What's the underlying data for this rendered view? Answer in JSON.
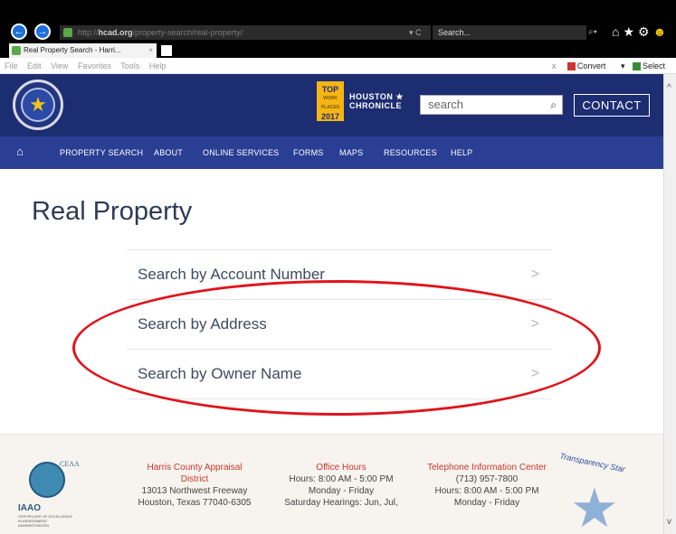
{
  "browser": {
    "url_prefix": "http://",
    "url_host": "hcad.org",
    "url_path": "/property-search/real-property/",
    "refresh_glyph": "▾ C",
    "search_placeholder": "Search...",
    "tab_title": "Real Property Search - Harri...",
    "tab_close": "×",
    "menu": [
      "File",
      "Edit",
      "View",
      "Favorites",
      "Tools",
      "Help"
    ],
    "toolbar_close": "x",
    "toolbar_convert": "Convert",
    "toolbar_convert_caret": "▾",
    "toolbar_select": "Select"
  },
  "header": {
    "search_placeholder": "search",
    "contact_label": "CONTACT",
    "badge_top": "TOP",
    "badge_mid": "WORK PLACES",
    "badge_year": "2017",
    "chronicle_line1": "HOUSTON ★",
    "chronicle_line2": "CHRONICLE"
  },
  "nav": {
    "items": [
      "PROPERTY SEARCH",
      "ABOUT",
      "ONLINE SERVICES",
      "FORMS",
      "MAPS",
      "RESOURCES",
      "HELP"
    ]
  },
  "main": {
    "title": "Real Property",
    "links": [
      {
        "label": "Search by Account Number"
      },
      {
        "label": "Search by Address"
      },
      {
        "label": "Search by Owner Name"
      }
    ]
  },
  "footer": {
    "logo_ceaa": "CEAA",
    "logo_iaao": "IAAO",
    "logo_cert": "CERTIFICATE OF EXCELLENCE IN ASSESSMENT ADMINISTRATION",
    "org": {
      "name_line1": "Harris County Appraisal",
      "name_line2": "District",
      "address1": "13013 Northwest Freeway",
      "address2": "Houston, Texas 77040-6305"
    },
    "hours": {
      "heading": "Office Hours",
      "line1": "Hours: 8:00 AM - 5:00 PM",
      "line2": "Monday - Friday",
      "line3": "Saturday Hearings: Jun, Jul,"
    },
    "phone": {
      "heading": "Telephone Information Center",
      "number": "(713) 957-7800",
      "line1": "Hours: 8:00 AM - 5:00 PM",
      "line2": "Monday - Friday"
    },
    "transparency": "Transparency Star"
  },
  "colors": {
    "header_bg": "#1d2d72",
    "nav_bg": "#2a3e94",
    "annotation_red": "#e0141b",
    "footer_heading": "#c5392c"
  }
}
